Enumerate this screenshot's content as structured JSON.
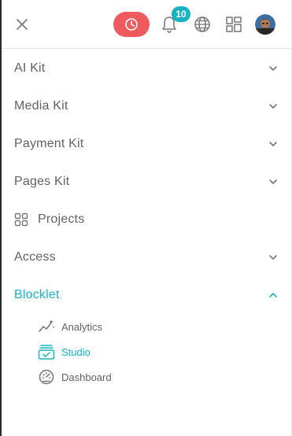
{
  "colors": {
    "accent": "#17b3c4",
    "danger": "#ef5a5f",
    "text": "#5f6368",
    "icon": "#757575"
  },
  "header": {
    "notification_count": "10"
  },
  "menu": {
    "items": [
      {
        "label": "AI Kit",
        "expanded": false
      },
      {
        "label": "Media Kit",
        "expanded": false
      },
      {
        "label": "Payment Kit",
        "expanded": false
      },
      {
        "label": "Pages Kit",
        "expanded": false
      },
      {
        "label": "Projects"
      },
      {
        "label": "Access",
        "expanded": false
      },
      {
        "label": "Blocklet",
        "expanded": true,
        "active": true
      }
    ],
    "subitems": [
      {
        "label": "Analytics",
        "icon": "analytics-icon"
      },
      {
        "label": "Studio",
        "icon": "studio-icon",
        "active": true
      },
      {
        "label": "Dashboard",
        "icon": "dashboard-icon"
      }
    ]
  }
}
